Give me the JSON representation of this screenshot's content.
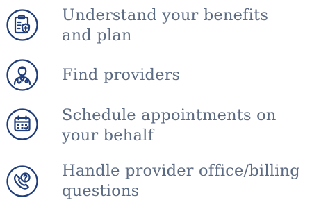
{
  "colors": {
    "icon_stroke": "#1f3d7a",
    "text": "#5c6b84",
    "background": "#ffffff"
  },
  "items": [
    {
      "icon": "clipboard-shield-icon",
      "label_line1": "Understand your benefits",
      "label_line2": "and plan"
    },
    {
      "icon": "doctor-icon",
      "label_line1": "Find providers",
      "label_line2": ""
    },
    {
      "icon": "calendar-icon",
      "label_line1": "Schedule appointments on",
      "label_line2": "your behalf"
    },
    {
      "icon": "phone-question-icon",
      "label_line1": "Handle provider office/billing",
      "label_line2": "questions"
    }
  ]
}
